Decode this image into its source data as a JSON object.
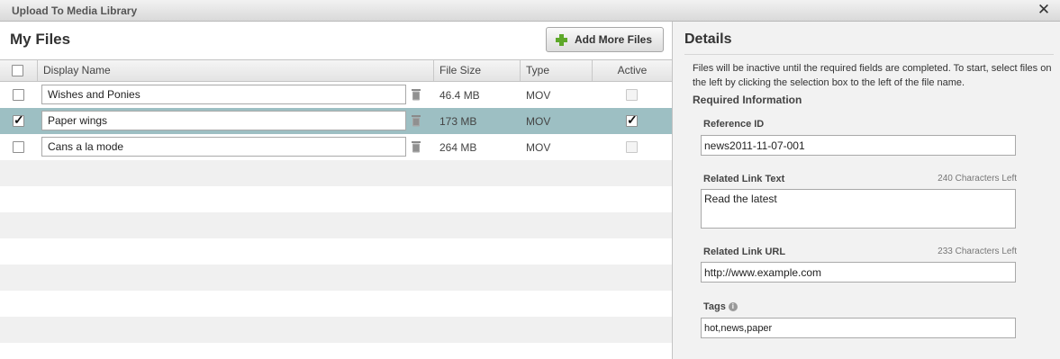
{
  "window": {
    "title": "Upload To Media Library",
    "close_glyph": "✕"
  },
  "files_panel": {
    "heading": "My Files",
    "add_button_label": "Add More Files",
    "columns": {
      "display_name": "Display Name",
      "file_size": "File Size",
      "type": "Type",
      "active": "Active"
    },
    "rows": [
      {
        "name": "Wishes and Ponies",
        "size": "46.4 MB",
        "type": "MOV",
        "selected": false,
        "active": false
      },
      {
        "name": "Paper wings",
        "size": "173 MB",
        "type": "MOV",
        "selected": true,
        "active": true
      },
      {
        "name": "Cans a la mode",
        "size": "264 MB",
        "type": "MOV",
        "selected": false,
        "active": false
      }
    ]
  },
  "details": {
    "heading": "Details",
    "description": "Files will be inactive until the required fields are completed. To start, select files on the left by clicking the selection box to the left of the file name.",
    "required_label": "Required Information",
    "reference_id": {
      "label": "Reference ID",
      "value": "news2011-11-07-001"
    },
    "related_link_text": {
      "label": "Related Link Text",
      "count": "240 Characters Left",
      "value": "Read the latest"
    },
    "related_link_url": {
      "label": "Related Link URL",
      "count": "233 Characters Left",
      "value": "http://www.example.com"
    },
    "tags": {
      "label": "Tags",
      "value": "hot,news,paper"
    }
  },
  "icons": {
    "add": "plus-icon",
    "delete": "trash-icon",
    "info": "info-icon",
    "close": "close-icon"
  },
  "colors": {
    "selected_row": "#9dbfc3",
    "add_icon": "#5ea82a"
  }
}
